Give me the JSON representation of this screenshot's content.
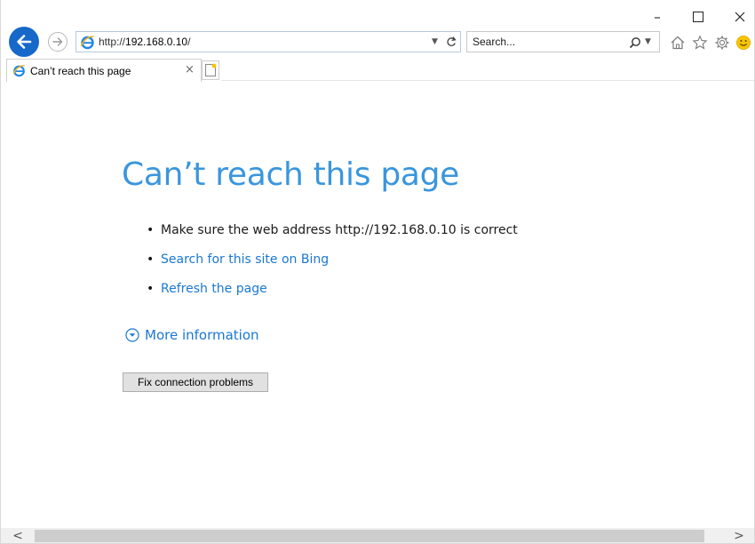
{
  "window": {
    "minimize_symbol": "–",
    "maximize_symbol": "☐",
    "close_symbol": "✕"
  },
  "navigation": {
    "address": {
      "protocol": "http://",
      "host": "192.168.0.10",
      "path": "/"
    },
    "search": {
      "placeholder": "Search..."
    }
  },
  "toolbar_icons": [
    "home-icon",
    "favorites-star-icon",
    "tools-gear-icon",
    "feedback-smiley-icon"
  ],
  "tab": {
    "title": "Can’t reach this page",
    "close_symbol": "×"
  },
  "content": {
    "heading": "Can’t reach this page",
    "bullets": [
      "Make sure the web address http://192.168.0.10 is correct",
      "Search for this site on Bing",
      "Refresh the page"
    ],
    "more_info": "More information",
    "fix_button": "Fix connection problems"
  },
  "scrollbar": {
    "left_arrow": "<",
    "right_arrow": ">"
  },
  "colors": {
    "accent": "#1668c9",
    "heading": "#3a96dd",
    "link": "#1a78d2"
  }
}
